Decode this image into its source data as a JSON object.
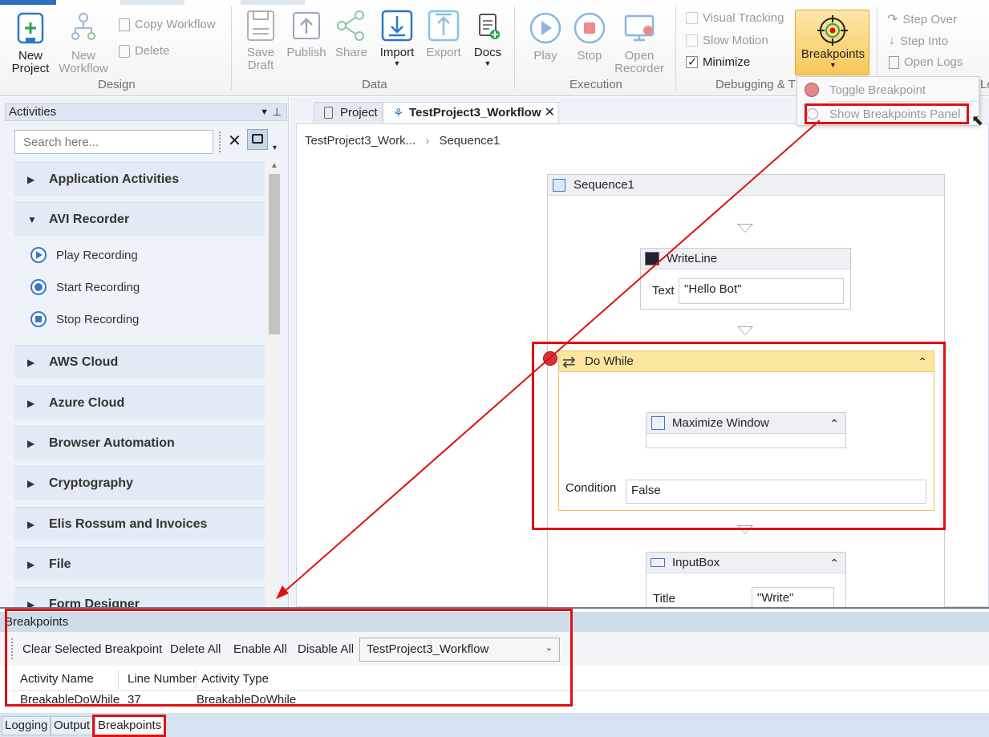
{
  "ribbon": {
    "design": {
      "new_project": "New\nProject",
      "new_workflow": "New\nWorkflow",
      "copy_workflow": "Copy Workflow",
      "delete": "Delete",
      "label": "Design"
    },
    "data": {
      "save_draft": "Save\nDraft",
      "publish": "Publish",
      "share": "Share",
      "import": "Import",
      "export": "Export",
      "docs": "Docs",
      "label": "Data"
    },
    "execution": {
      "play": "Play",
      "stop": "Stop",
      "open_recorder": "Open\nRecorder",
      "label": "Execution"
    },
    "debugging": {
      "visual_tracking": "Visual Tracking",
      "slow_motion": "Slow Motion",
      "minimize": "Minimize",
      "minimize_checked": true,
      "breakpoints": "Breakpoints",
      "label": "Debugging & T",
      "step_over": "Step Over",
      "step_into": "Step Into",
      "open_logs": "Open Logs"
    },
    "overflow_label": "Lo"
  },
  "breakpoints_menu": {
    "toggle": "Toggle Breakpoint",
    "show_panel": "Show Breakpoints Panel"
  },
  "activities": {
    "title": "Activities",
    "search_placeholder": "Search here...",
    "categories": [
      "Application Activities",
      "AVI Recorder",
      "AWS Cloud",
      "Azure Cloud",
      "Browser Automation",
      "Cryptography",
      "Elis Rossum and Invoices",
      "File",
      "Form Designer"
    ],
    "avi_items": [
      "Play Recording",
      "Start Recording",
      "Stop Recording"
    ]
  },
  "document": {
    "tabs": [
      "Project",
      "TestProject3_Workflow"
    ],
    "breadcrumb": [
      "TestProject3_Work...",
      "Sequence1"
    ],
    "sequence_title": "Sequence1",
    "writeline": {
      "title": "WriteLine",
      "text_label": "Text",
      "text_value": "\"Hello Bot\""
    },
    "dowhile": {
      "title": "Do While",
      "condition_label": "Condition",
      "condition_value": "False"
    },
    "maximize": {
      "title": "Maximize Window"
    },
    "inputbox": {
      "title": "InputBox",
      "title_label": "Title",
      "title_value": "\"Write\""
    }
  },
  "breakpoints_panel": {
    "title": "Breakpoints",
    "clear_selected": "Clear Selected Breakpoint",
    "delete_all": "Delete All",
    "enable_all": "Enable All",
    "disable_all": "Disable All",
    "workflow_select": "TestProject3_Workflow",
    "columns": [
      "Activity Name",
      "Line Number",
      "Activity Type"
    ],
    "rows": [
      [
        "BreakableDoWhile",
        "37",
        "BreakableDoWhile"
      ]
    ]
  },
  "bottom_tabs": [
    "Logging",
    "Output",
    "Breakpoints"
  ],
  "colors": {
    "accent_red": "#e01010",
    "breakpoint_orange": "#f7c85a",
    "blue": "#2b79c6"
  }
}
